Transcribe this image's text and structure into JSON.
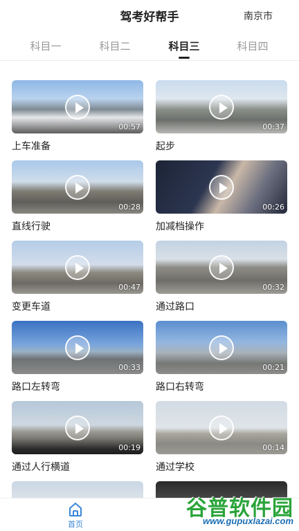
{
  "header": {
    "title": "驾考好帮手",
    "city": "南京市"
  },
  "tabs": [
    {
      "label": "科目一"
    },
    {
      "label": "科目二"
    },
    {
      "label": "科目三"
    },
    {
      "label": "科目四"
    }
  ],
  "active_tab": "科目三",
  "videos": [
    {
      "title": "上车准备",
      "duration": "00:57"
    },
    {
      "title": "起步",
      "duration": "00:37"
    },
    {
      "title": "直线行驶",
      "duration": "00:28"
    },
    {
      "title": "加减档操作",
      "duration": "00:26"
    },
    {
      "title": "变更车道",
      "duration": "00:47"
    },
    {
      "title": "通过路口",
      "duration": "00:32"
    },
    {
      "title": "路口左转弯",
      "duration": "00:33"
    },
    {
      "title": "路口右转弯",
      "duration": "00:21"
    },
    {
      "title": "通过人行横道",
      "duration": "00:19"
    },
    {
      "title": "通过学校",
      "duration": "00:14"
    }
  ],
  "bottom_nav": {
    "home_label": "首页"
  },
  "watermark": {
    "text": "谷普软件园",
    "url": "www.gupuxlazai.com"
  }
}
